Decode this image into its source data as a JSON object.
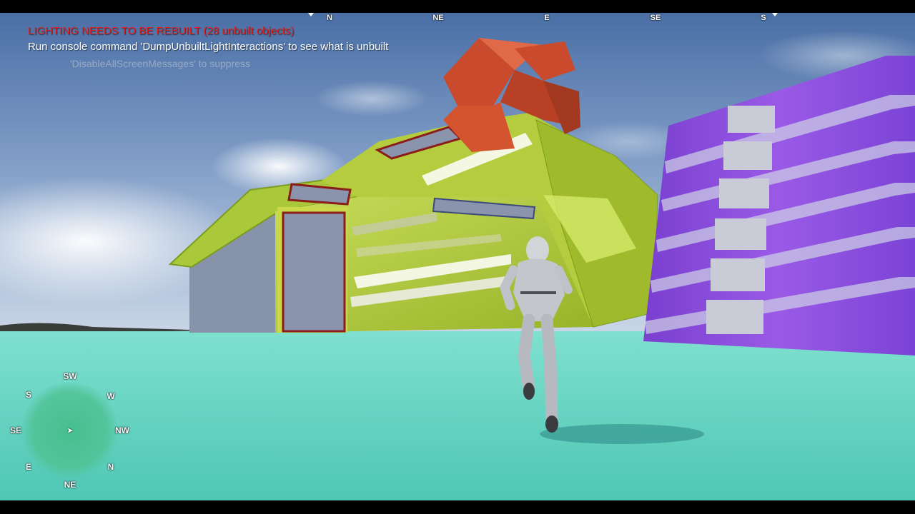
{
  "hud": {
    "compass": {
      "headings": [
        "N",
        "NE",
        "E",
        "SE",
        "S"
      ]
    },
    "messages": {
      "warning": "LIGHTING NEEDS TO BE REBUILT (28 unbuilt objects)",
      "info": "Run console command 'DumpUnbuiltLightInteractions' to see what is unbuilt",
      "suppress": "'DisableAllScreenMessages' to suppress"
    },
    "minimap": {
      "directions": {
        "sw": "SW",
        "s": "S",
        "w": "W",
        "se": "SE",
        "nw": "NW",
        "e": "E",
        "n": "N",
        "ne": "NE"
      },
      "player_icon": "player-arrow-icon"
    }
  },
  "colors": {
    "warning_text": "#e0201c",
    "info_text": "#ffffff",
    "ground": "#62d2c0",
    "sky_top": "#4a6fa5",
    "building_green": "#a9c83a",
    "building_gray": "#8792ab",
    "accent_red": "#c94a2c",
    "purple_block": "#8a44d8",
    "minimap_disc": "#46be8c"
  }
}
